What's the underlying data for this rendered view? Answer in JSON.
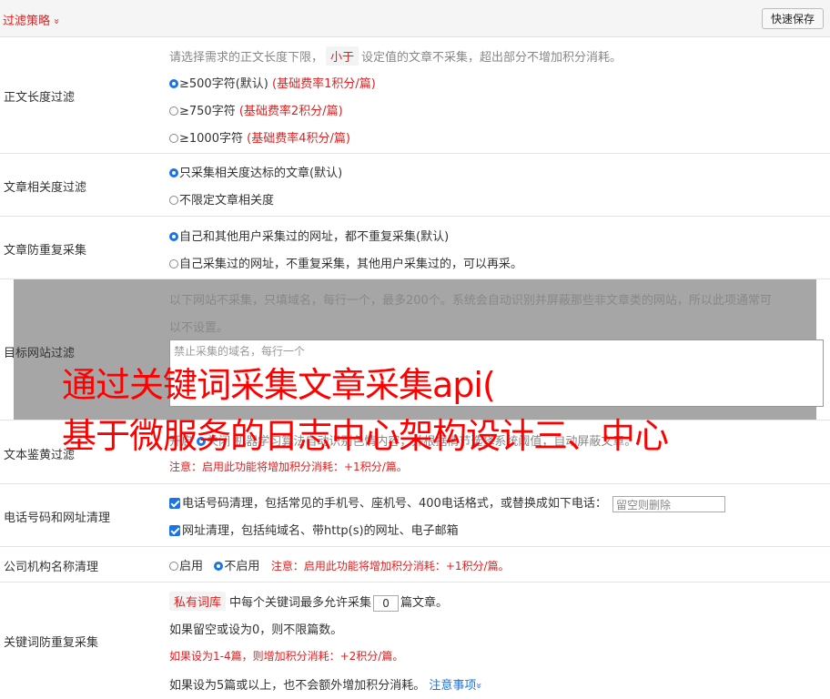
{
  "header": {
    "title": "过滤策略",
    "chevron": "»",
    "save_button": "快速保存"
  },
  "length_filter": {
    "label": "正文长度过滤",
    "desc_pre": "请选择需求的正文长度下限，",
    "desc_tag": "小于",
    "desc_post": "设定值的文章不采集，超出部分不增加积分消耗。",
    "options": [
      {
        "text": "≥500字符(默认)",
        "note": "(基础费率1积分/篇)",
        "checked": true
      },
      {
        "text": "≥750字符",
        "note": "(基础费率2积分/篇)",
        "checked": false
      },
      {
        "text": "≥1000字符",
        "note": "(基础费率4积分/篇)",
        "checked": false
      }
    ]
  },
  "relevance": {
    "label": "文章相关度过滤",
    "options": [
      {
        "text": "只采集相关度达标的文章(默认)",
        "checked": true
      },
      {
        "text": "不限定文章相关度",
        "checked": false
      }
    ]
  },
  "dedupe": {
    "label": "文章防重复采集",
    "options": [
      {
        "text": "自己和其他用户采集过的网址，都不重复采集(默认)",
        "checked": true
      },
      {
        "text": "自己采集过的网址，不重复采集，其他用户采集过的，可以再采。",
        "checked": false
      }
    ]
  },
  "target_site": {
    "label": "目标网站过滤",
    "desc_line1": "以下网站不采集，只填域名，每行一个，最多200个。系统会自动识别并屏蔽那些非文章类的网站，所以此项通常可",
    "desc_line2": "以不设置。",
    "placeholder": "禁止采集的域名，每行一个"
  },
  "porn_filter": {
    "label": "文本鉴黄过滤",
    "line1_start": "开启",
    "line1_mid": "关闭",
    "line1_end": "机器学习算法自动识别色情内容，并根据情节选择系统阈值，自动屏蔽文章。",
    "note": "注意：启用此功能将增加积分消耗：+1积分/篇。"
  },
  "phone_url": {
    "label": "电话号码和网址清理",
    "phone_text": "电话号码清理，包括常见的手机号、座机号、400电话格式，或替换成如下电话：",
    "phone_placeholder": "留空则删除",
    "url_text": "网址清理，包括纯域名、带http(s)的网址、电子邮箱"
  },
  "company": {
    "label": "公司机构名称清理",
    "on": "启用",
    "off": "不启用",
    "note": "注意：启用此功能将增加积分消耗：+1积分/篇。"
  },
  "keyword_dedupe": {
    "label": "关键词防重复采集",
    "tag": "私有词库",
    "line1_a": "中每个关键词最多允许采集",
    "count": "0",
    "line1_b": "篇文章。",
    "line2": "如果留空或设为0，则不限篇数。",
    "line3": "如果设为1-4篇，则增加积分消耗：+2积分/篇。",
    "line4": "如果设为5篇或以上，也不会额外增加积分消耗。",
    "link": "注意事项",
    "link_chevron": "»"
  },
  "overlay": {
    "line1": "通过关键词采集文章采集api(",
    "line2": "基于微服务的日志中心架构设计三、中心"
  }
}
